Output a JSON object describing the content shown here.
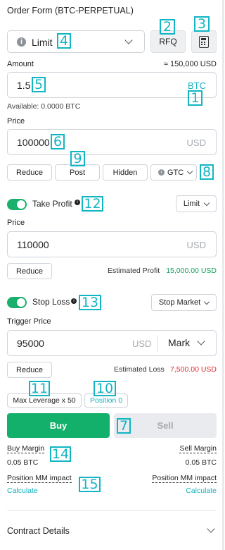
{
  "title": "Order Form (BTC-PERPETUAL)",
  "order_type": {
    "value": "Limit",
    "icon": "info-icon"
  },
  "rfq_label": "RFQ",
  "calculator_icon": "calculator-icon",
  "amount": {
    "label": "Amount",
    "approx": "≈ 150,000 USD",
    "value": "1.5",
    "unit": "BTC",
    "available": "Available: 0.0000 BTC"
  },
  "price": {
    "label": "Price",
    "value": "100000",
    "unit": "USD"
  },
  "exec_options": {
    "reduce": "Reduce",
    "post": "Post",
    "hidden": "Hidden",
    "tif": "GTC"
  },
  "take_profit": {
    "label": "Take Profit",
    "type": "Limit",
    "price_label": "Price",
    "price_value": "110000",
    "unit": "USD",
    "reduce": "Reduce",
    "estimated_label": "Estimated Profit",
    "estimated_value": "15,000.00 USD"
  },
  "stop_loss": {
    "label": "Stop Loss",
    "type": "Stop Market",
    "trigger_label": "Trigger Price",
    "trigger_value": "95000",
    "unit": "USD",
    "trigger_source": "Mark",
    "reduce": "Reduce",
    "estimated_label": "Estimated Loss",
    "estimated_value": "7,500.00 USD"
  },
  "max_leverage": "Max Leverage x 50",
  "position": "Position 0",
  "buy_label": "Buy",
  "sell_label": "Sell",
  "margins": {
    "buy_label": "Buy Margin",
    "buy_value": "0.05 BTC",
    "sell_label": "Sell Margin",
    "sell_value": "0.05 BTC"
  },
  "mm_impact": {
    "left_label": "Position MM impact",
    "left_action": "Calculate",
    "right_label": "Position MM impact",
    "right_action": "Calculate"
  },
  "contract_details": "Contract Details",
  "markers": [
    "1",
    "2",
    "3",
    "4",
    "5",
    "6",
    "7",
    "8",
    "9",
    "10",
    "11",
    "12",
    "13",
    "14",
    "15"
  ],
  "colors": {
    "buy_green": "#12b06a",
    "marker": "#12b5c4",
    "profit": "#12a15b",
    "loss": "#e02b2b",
    "link": "#17b3c1"
  }
}
